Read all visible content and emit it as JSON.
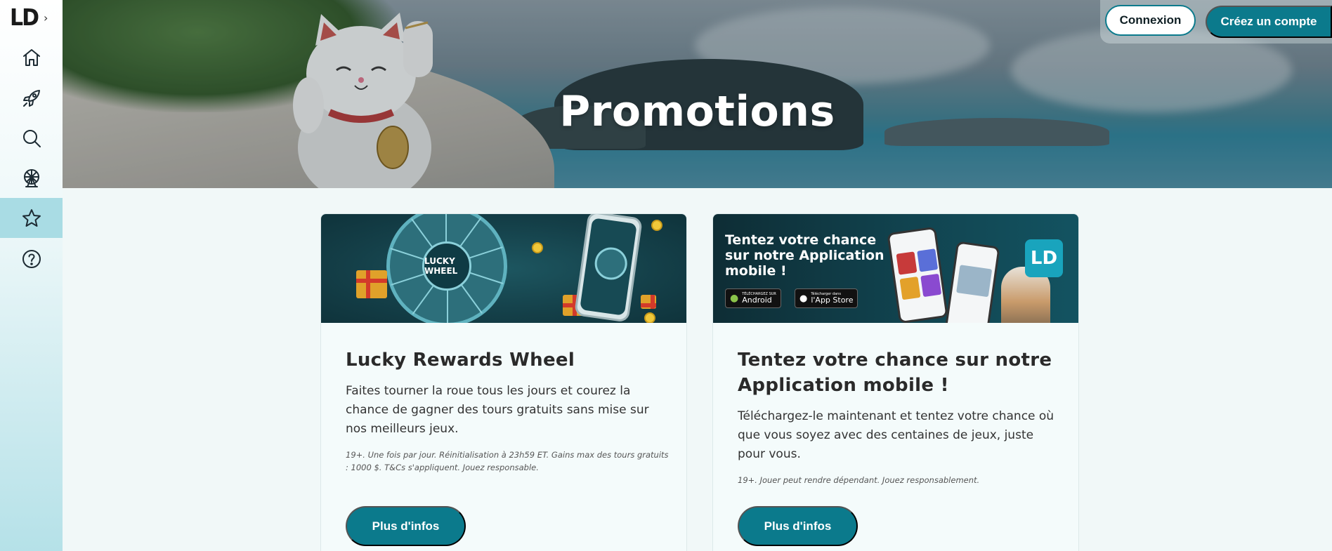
{
  "sidebar": {
    "logo": "LD",
    "expand_icon": "chevron-right-icon",
    "items": [
      {
        "name": "home",
        "icon": "home-icon",
        "active": false
      },
      {
        "name": "launch",
        "icon": "rocket-icon",
        "active": false
      },
      {
        "name": "search",
        "icon": "search-icon",
        "active": false
      },
      {
        "name": "live",
        "icon": "ferris-wheel-icon",
        "active": false
      },
      {
        "name": "promotions",
        "icon": "star-icon",
        "active": true
      },
      {
        "name": "help",
        "icon": "help-icon",
        "active": false
      }
    ]
  },
  "header": {
    "login_label": "Connexion",
    "signup_label": "Créez un compte"
  },
  "hero": {
    "title": "Promotions"
  },
  "promotions": [
    {
      "banner_text": "LUCKY WHEEL",
      "title": "Lucky Rewards Wheel",
      "description": "Faites tourner la roue tous les jours et courez la chance de gagner des tours gratuits sans mise sur nos meilleurs jeux.",
      "fine_print": "19+. Une fois par jour. Réinitialisation à 23h59 ET. Gains max des tours gratuits : 1000 $. T&Cs s'appliquent. Jouez responsable.",
      "button_label": "Plus d'infos"
    },
    {
      "banner_text": "Tentez votre chance sur notre Application mobile !",
      "banner_android_small": "TÉLÉCHARGEZ SUR",
      "banner_android_big": "Android",
      "banner_apple_small": "Télécharger dans",
      "banner_apple_big": "l'App Store",
      "banner_badge": "LD",
      "title": "Tentez votre chance sur notre Application mobile !",
      "description": "Téléchargez-le maintenant et tentez votre chance où que vous soyez avec des centaines de jeux, juste pour vous.",
      "fine_print": "19+. Jouer peut rendre dépendant. Jouez responsablement.",
      "button_label": "Plus d'infos"
    }
  ],
  "colors": {
    "accent": "#0b7a8c",
    "sidebar_active": "#a9dce4",
    "page_bg": "#f1f8f8"
  }
}
